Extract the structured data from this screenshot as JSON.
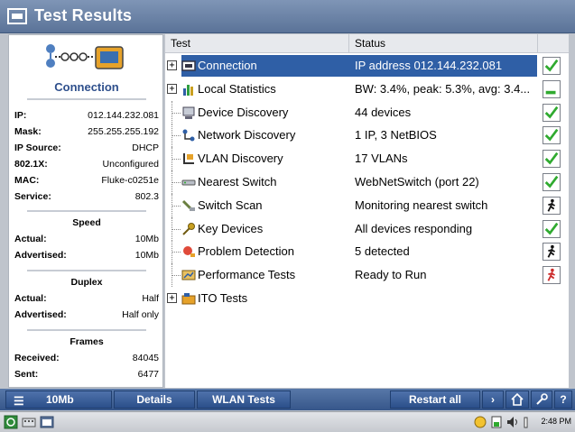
{
  "window": {
    "title": "Test Results"
  },
  "left_panel": {
    "title": "Connection",
    "info": [
      {
        "key": "IP:",
        "value": "012.144.232.081"
      },
      {
        "key": "Mask:",
        "value": "255.255.255.192"
      },
      {
        "key": "IP Source:",
        "value": "DHCP"
      },
      {
        "key": "802.1X:",
        "value": "Unconfigured"
      },
      {
        "key": "MAC:",
        "value": "Fluke-c0251e"
      },
      {
        "key": "Service:",
        "value": "802.3"
      }
    ],
    "speed": {
      "title": "Speed",
      "actual_label": "Actual:",
      "actual": "10Mb",
      "advertised_label": "Advertised:",
      "advertised": "10Mb"
    },
    "duplex": {
      "title": "Duplex",
      "actual_label": "Actual:",
      "actual": "Half",
      "advertised_label": "Advertised:",
      "advertised": "Half only"
    },
    "frames": {
      "title": "Frames",
      "received_label": "Received:",
      "received": "84045",
      "sent_label": "Sent:",
      "sent": "6477"
    }
  },
  "table": {
    "columns": {
      "test": "Test",
      "status": "Status"
    },
    "rows": [
      {
        "name": "Connection",
        "status": "IP address 012.144.232.081",
        "state": "pass",
        "expander": "+",
        "icon": "connection-icon",
        "selected": true
      },
      {
        "name": "Local Statistics",
        "status": "BW: 3.4%, peak: 5.3%, avg: 3.4...",
        "state": "meter",
        "expander": "+",
        "icon": "local-statistics-icon",
        "selected": false
      },
      {
        "name": "Device Discovery",
        "status": "44 devices",
        "state": "pass",
        "expander": "",
        "icon": "device-discovery-icon",
        "selected": false
      },
      {
        "name": "Network Discovery",
        "status": "1 IP, 3 NetBIOS",
        "state": "pass",
        "expander": "",
        "icon": "network-discovery-icon",
        "selected": false
      },
      {
        "name": "VLAN Discovery",
        "status": "17 VLANs",
        "state": "pass",
        "expander": "",
        "icon": "vlan-discovery-icon",
        "selected": false
      },
      {
        "name": "Nearest Switch",
        "status": "WebNetSwitch (port 22)",
        "state": "pass",
        "expander": "",
        "icon": "nearest-switch-icon",
        "selected": false
      },
      {
        "name": "Switch Scan",
        "status": "Monitoring nearest switch",
        "state": "running",
        "expander": "",
        "icon": "switch-scan-icon",
        "selected": false
      },
      {
        "name": "Key Devices",
        "status": "All devices responding",
        "state": "pass",
        "expander": "",
        "icon": "key-devices-icon",
        "selected": false
      },
      {
        "name": "Problem Detection",
        "status": "5 detected",
        "state": "running",
        "expander": "",
        "icon": "problem-detection-icon",
        "selected": false
      },
      {
        "name": "Performance Tests",
        "status": "Ready to Run",
        "state": "ready",
        "expander": "",
        "icon": "performance-tests-icon",
        "selected": false
      },
      {
        "name": "ITO Tests",
        "status": "",
        "state": "none",
        "expander": "+",
        "icon": "ito-tests-icon",
        "selected": false
      }
    ]
  },
  "bottom_bar": {
    "speed": "10Mb",
    "details": "Details",
    "wlan_tests": "WLAN Tests",
    "restart_all": "Restart all"
  },
  "taskbar": {
    "clock": "2:48 PM"
  },
  "colors": {
    "title_bar": "#5b7398",
    "selection": "#2f5fa6",
    "pass": "#2faa2f",
    "fail": "#cc2a2a",
    "accent_text": "#2e4f8c"
  }
}
